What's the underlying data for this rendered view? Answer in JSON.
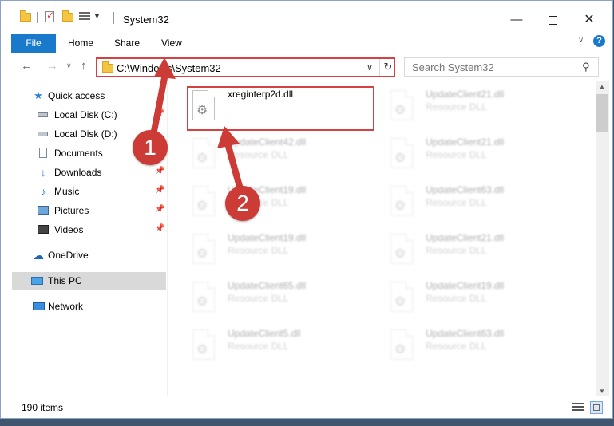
{
  "window": {
    "title": "System32",
    "controls": {
      "minimize": "—",
      "maximize": "",
      "close": "✕"
    }
  },
  "ribbon": {
    "file_tab": "File",
    "tabs": [
      "Home",
      "Share",
      "View"
    ],
    "collapse_glyph": "∨",
    "help_glyph": "?"
  },
  "navigation": {
    "back_glyph": "←",
    "forward_glyph": "→",
    "recent_glyph": "∨",
    "up_glyph": "↑",
    "address_path": "C:\\Windows\\System32",
    "address_dropdown_glyph": "∨",
    "refresh_glyph": "↻",
    "search_placeholder": "Search System32",
    "search_glyph": "⚲"
  },
  "sidebar": {
    "items": [
      {
        "label": "Quick access",
        "icon": "star-icon",
        "pinned": false
      },
      {
        "label": "Local Disk (C:)",
        "icon": "drive-icon",
        "pinned": true
      },
      {
        "label": "Local Disk (D:)",
        "icon": "drive-icon",
        "pinned": true
      },
      {
        "label": "Documents",
        "icon": "documents-icon",
        "pinned": true
      },
      {
        "label": "Downloads",
        "icon": "download-icon",
        "pinned": true
      },
      {
        "label": "Music",
        "icon": "music-icon",
        "pinned": true
      },
      {
        "label": "Pictures",
        "icon": "pictures-icon",
        "pinned": true
      },
      {
        "label": "Videos",
        "icon": "videos-icon",
        "pinned": true
      },
      {
        "label": "OneDrive",
        "icon": "onedrive-icon",
        "pinned": false
      },
      {
        "label": "This PC",
        "icon": "computer-icon",
        "pinned": false,
        "selected": true
      },
      {
        "label": "Network",
        "icon": "network-icon",
        "pinned": false
      }
    ],
    "pin_glyph": "📌"
  },
  "files": [
    {
      "name": "xreginterp2d.dll",
      "type": "",
      "highlighted": true
    },
    {
      "name": "UpdateClient21.dll",
      "type": "Resource DLL"
    },
    {
      "name": "UpdateClient42.dll",
      "type": "Resource DLL"
    },
    {
      "name": "UpdateClient21.dll",
      "type": "Resource DLL"
    },
    {
      "name": "UpdateClient19.dll",
      "type": "Resource DLL"
    },
    {
      "name": "UpdateClient63.dll",
      "type": "Resource DLL"
    },
    {
      "name": "UpdateClient19.dll",
      "type": "Resource DLL"
    },
    {
      "name": "UpdateClient21.dll",
      "type": "Resource DLL"
    },
    {
      "name": "UpdateClient65.dll",
      "type": "Resource DLL"
    },
    {
      "name": "UpdateClient19.dll",
      "type": "Resource DLL"
    },
    {
      "name": "UpdateClient5.dll",
      "type": "Resource DLL"
    },
    {
      "name": "UpdateClient63.dll",
      "type": "Resource DLL"
    }
  ],
  "statusbar": {
    "item_count": "190 items"
  },
  "annotations": {
    "step1": "1",
    "step2": "2",
    "color": "#cc3b36"
  }
}
